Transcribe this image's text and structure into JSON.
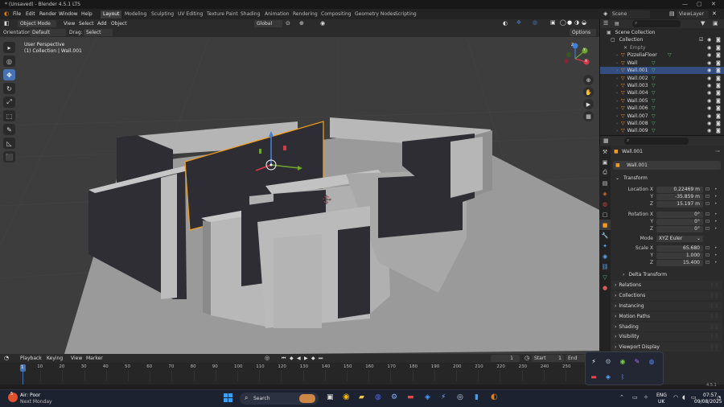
{
  "window": {
    "title": "* (Unsaved) - Blender 4.5.1 LTS",
    "controls": [
      "—",
      "▢",
      "✕"
    ]
  },
  "menu": {
    "items": [
      "File",
      "Edit",
      "Render",
      "Window",
      "Help"
    ]
  },
  "workspaces": [
    "Layout",
    "Modeling",
    "Sculpting",
    "UV Editing",
    "Texture Paint",
    "Shading",
    "Animation",
    "Rendering",
    "Compositing",
    "Geometry Nodes",
    "Scripting"
  ],
  "scene": {
    "name": "Scene",
    "view_layer": "ViewLayer"
  },
  "viewport_header": {
    "mode": "Object Mode",
    "view": "View",
    "select": "Select",
    "add": "Add",
    "object": "Object",
    "orientation_space": "Global"
  },
  "viewport_header2": {
    "orientation_label": "Orientation:",
    "orientation_value": "Default",
    "drag_label": "Drag:",
    "drag_value": "Select Box",
    "options": "Options"
  },
  "viewport_info": {
    "line1": "User Perspective",
    "line2": "(1) Collection | Wall.001"
  },
  "tools": [
    "▸",
    "◎",
    "✥",
    "↻",
    "⤢",
    "⬚",
    "✎",
    "◺",
    "⬛"
  ],
  "nav_axes": {
    "x": "X",
    "y": "Y",
    "z": "Z"
  },
  "outliner": {
    "search_placeholder": "",
    "root": "Scene Collection",
    "collection": "Collection",
    "items": [
      "Empty",
      "PizzeliaFloor",
      "Wall",
      "Wall.001",
      "Wall.002",
      "Wall.003",
      "Wall.004",
      "Wall.005",
      "Wall.006",
      "Wall.007",
      "Wall.008",
      "Wall.009"
    ],
    "selected": "Wall.001"
  },
  "properties": {
    "search_placeholder": "",
    "object_name": "Wall.001",
    "object_field": "Wall.001",
    "transform": {
      "section": "Transform",
      "location_label": "Location X",
      "location": [
        "0.22469 m",
        "-35.859 m",
        "15.197 m"
      ],
      "rotation_label": "Rotation X",
      "rotation": [
        "0°",
        "0°",
        "0°"
      ],
      "mode_label": "Mode",
      "mode": "XYZ Euler",
      "scale_label": "Scale X",
      "scale": [
        "65.680",
        "1.000",
        "15.400"
      ],
      "y_label": "Y",
      "z_label": "Z"
    },
    "sections": [
      "Delta Transform",
      "Relations",
      "Collections",
      "Instancing",
      "Motion Paths",
      "Shading",
      "Visibility",
      "Viewport Display"
    ]
  },
  "timeline": {
    "playback": "Playback",
    "keying": "Keying",
    "view": "View",
    "marker": "Marker",
    "current_frame": "1",
    "start_label": "Start",
    "start": "1",
    "end_label": "End",
    "ticks": [
      "1",
      "10",
      "20",
      "30",
      "40",
      "50",
      "60",
      "70",
      "80",
      "90",
      "100",
      "110",
      "120",
      "130",
      "140",
      "150",
      "160",
      "170",
      "180",
      "190",
      "200",
      "210",
      "220",
      "230",
      "240",
      "250"
    ]
  },
  "status": {
    "version": "4.5.1"
  },
  "taskbar": {
    "weather_temp": "5",
    "weather_line1": "Air: Poor",
    "weather_line2": "Next Monday",
    "search_placeholder": "Search",
    "lang_line1": "ENG",
    "lang_line2": "UK",
    "time": "07:57",
    "date": "09/08/2025"
  },
  "colors": {
    "accent": "#4772b3",
    "selection_orange": "#f5a020",
    "wall": "#b3b3b3",
    "wall_dark": "#2e2d33",
    "floor": "#989898",
    "axis_x": "#d23a47",
    "axis_y": "#6ea62e",
    "axis_z": "#3f7fd6"
  }
}
